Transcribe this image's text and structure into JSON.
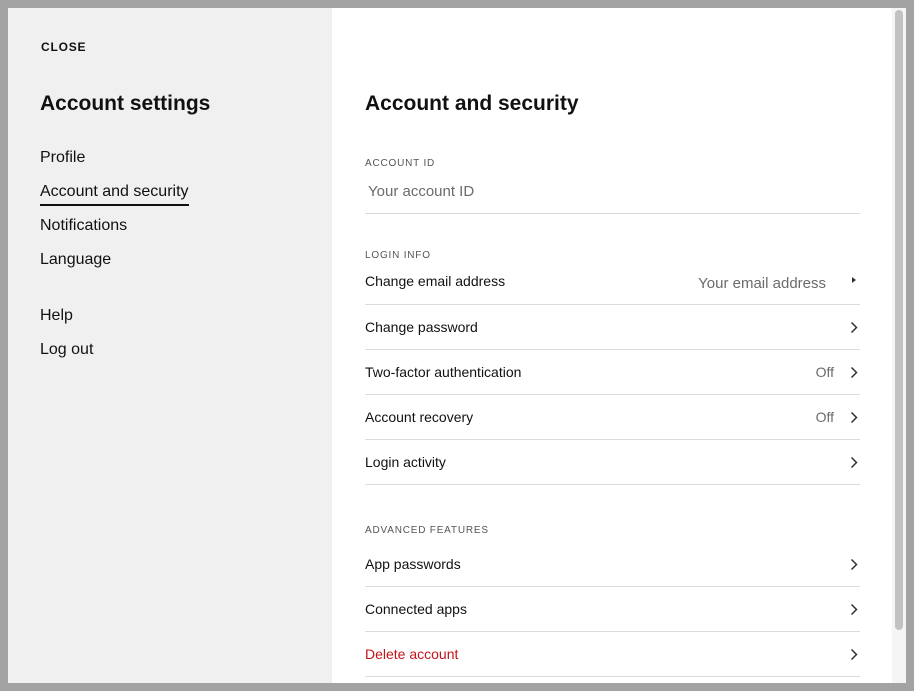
{
  "sidebar": {
    "close_label": "CLOSE",
    "title": "Account settings",
    "nav_items": [
      {
        "label": "Profile",
        "active": false
      },
      {
        "label": "Account and security",
        "active": true
      },
      {
        "label": "Notifications",
        "active": false
      },
      {
        "label": "Language",
        "active": false
      }
    ],
    "secondary_items": [
      {
        "label": "Help"
      },
      {
        "label": "Log out"
      }
    ]
  },
  "main": {
    "title": "Account and security",
    "account_id": {
      "label": "ACCOUNT ID",
      "placeholder": "Your account ID"
    },
    "login_info": {
      "label": "LOGIN INFO",
      "rows": [
        {
          "label": "Change email address",
          "value": "Your email address"
        },
        {
          "label": "Change password",
          "value": ""
        },
        {
          "label": "Two-factor authentication",
          "value": "Off"
        },
        {
          "label": "Account recovery",
          "value": "Off"
        },
        {
          "label": "Login activity",
          "value": ""
        }
      ]
    },
    "advanced_features": {
      "label": "ADVANCED FEATURES",
      "rows": [
        {
          "label": "App passwords"
        },
        {
          "label": "Connected apps"
        },
        {
          "label": "Delete account"
        }
      ]
    }
  },
  "colors": {
    "sidebar_bg": "#f0f0f0",
    "danger": "#c4141b",
    "backdrop": "#a3a3a3"
  },
  "icons": {
    "row_chevron": "chevron-right-icon"
  }
}
